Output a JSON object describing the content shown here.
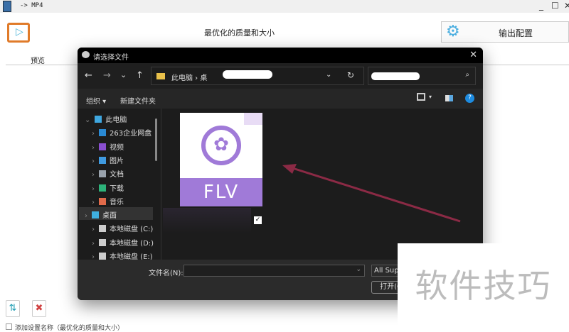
{
  "window": {
    "title": "-> MP4",
    "minimize": "_",
    "maximize": "☐",
    "close": "✕"
  },
  "app": {
    "preset": "最优化的质量和大小",
    "output_button": "输出配置",
    "tab_preview": "预览",
    "add_setting_label": "添加设置名称（最优化的质量和大小）"
  },
  "dialog": {
    "title": "请选择文件",
    "close": "✕",
    "nav": {
      "back": "←",
      "forward": "→",
      "recent": "⌄",
      "up": "↑"
    },
    "breadcrumb": [
      "此电脑",
      "桌"
    ],
    "address_dropdown": "⌄",
    "refresh": "↻",
    "search_icon": "⌕",
    "toolbar": {
      "organize": "组织 ▾",
      "new_folder": "新建文件夹",
      "help": "?"
    },
    "sidebar": [
      {
        "label": "此电脑",
        "icon": "pc-icon",
        "color": "#3fa7e0"
      },
      {
        "label": "263企业网盘",
        "icon": "cloud-drive-icon",
        "color": "#2a8ad4"
      },
      {
        "label": "视频",
        "icon": "video-icon",
        "color": "#8a4fd0"
      },
      {
        "label": "图片",
        "icon": "picture-icon",
        "color": "#3f9ae0"
      },
      {
        "label": "文档",
        "icon": "document-icon",
        "color": "#9aa3ad"
      },
      {
        "label": "下载",
        "icon": "download-icon",
        "color": "#2db37a"
      },
      {
        "label": "音乐",
        "icon": "music-icon",
        "color": "#e06a4a"
      },
      {
        "label": "桌面",
        "icon": "desktop-icon",
        "color": "#3fb0e0"
      },
      {
        "label": "本地磁盘 (C:)",
        "icon": "drive-icon",
        "color": "#cccccc"
      },
      {
        "label": "本地磁盘 (D:)",
        "icon": "drive-icon",
        "color": "#cccccc"
      },
      {
        "label": "本地磁盘 (E:)",
        "icon": "drive-icon",
        "color": "#cccccc"
      }
    ],
    "file": {
      "type_label": "FLV",
      "accent": "#a07ad8"
    },
    "filename_label": "文件名(N):",
    "filename_value": "",
    "filter": "All Supported",
    "open_button": "打开(O)"
  },
  "watermark": "软件技巧"
}
